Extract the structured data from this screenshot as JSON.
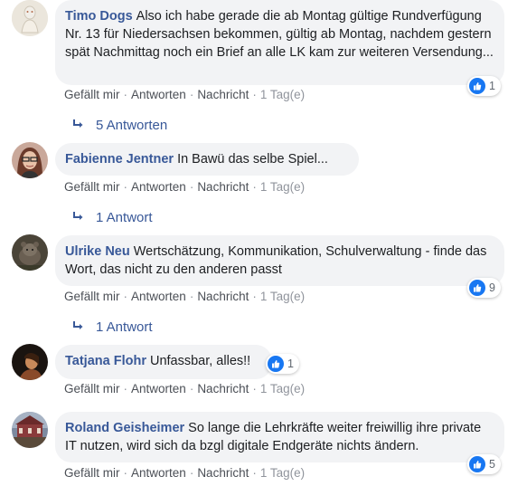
{
  "comments": [
    {
      "author": "Timo Dogs",
      "text": "Also ich habe gerade die ab Montag gültige Rundverfügung Nr. 13 für Niedersachsen bekommen, gültig ab Montag, nachdem gestern spät Nachmittag noch ein Brief an alle LK kam zur weiteren Versendung...",
      "like_label": "Gefällt mir",
      "reply_label": "Antworten",
      "message_label": "Nachricht",
      "time": "1 Tag(e)",
      "reaction_count": "1",
      "replies_label": "5 Antworten"
    },
    {
      "author": "Fabienne Jentner",
      "text": "In Bawü das selbe Spiel...",
      "like_label": "Gefällt mir",
      "reply_label": "Antworten",
      "message_label": "Nachricht",
      "time": "1 Tag(e)",
      "replies_label": "1 Antwort"
    },
    {
      "author": "Ulrike Neu",
      "text": "Wertschätzung, Kommunikation, Schulverwaltung - finde das Wort, das nicht zu den anderen passt",
      "like_label": "Gefällt mir",
      "reply_label": "Antworten",
      "message_label": "Nachricht",
      "time": "1 Tag(e)",
      "reaction_count": "9",
      "replies_label": "1 Antwort"
    },
    {
      "author": "Tatjana Flohr",
      "text": "Unfassbar, alles!!",
      "like_label": "Gefällt mir",
      "reply_label": "Antworten",
      "message_label": "Nachricht",
      "time": "1 Tag(e)",
      "reaction_count": "1"
    },
    {
      "author": "Roland Geisheimer",
      "text": "So lange die Lehrkräfte weiter freiwillig ihre private IT nutzen, wird sich da bzgl digitale Endgeräte nichts ändern.",
      "like_label": "Gefällt mir",
      "reply_label": "Antworten",
      "message_label": "Nachricht",
      "time": "1 Tag(e)",
      "reaction_count": "5"
    }
  ],
  "separator": "·",
  "colors": {
    "author": "#385898",
    "bubble": "#f2f3f5",
    "like_blue": "#1877f2",
    "meta": "#606770"
  },
  "icons": {
    "reaction": "like-thumb-icon",
    "replies": "reply-arrow-icon"
  }
}
